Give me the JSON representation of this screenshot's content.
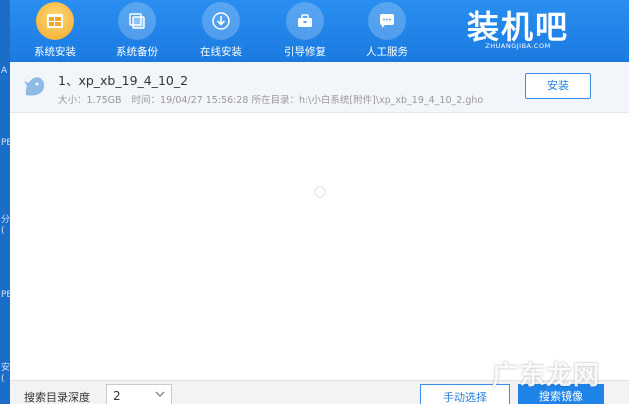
{
  "nav": {
    "items": [
      {
        "label": "系统安装",
        "icon": "windows-install-icon",
        "active": true
      },
      {
        "label": "系统备份",
        "icon": "backup-icon",
        "active": false
      },
      {
        "label": "在线安装",
        "icon": "download-icon",
        "active": false
      },
      {
        "label": "引导修复",
        "icon": "toolbox-icon",
        "active": false
      },
      {
        "label": "人工服务",
        "icon": "chat-icon",
        "active": false
      }
    ]
  },
  "logo": {
    "text": "装机吧",
    "sub": "ZHUANGJIBA.COM"
  },
  "left_strip": {
    "chars": [
      "A",
      "PE",
      "分",
      "(",
      "PE",
      "安",
      "("
    ]
  },
  "image_list": [
    {
      "title": "1、xp_xb_19_4_10_2",
      "size_label": "大小：1.75GB",
      "time_label": "时间：19/04/27 15:56:28",
      "path_label": "所在目录：h:\\小白系统[附件]\\xp_xb_19_4_10_2.gho",
      "action_label": "安装"
    }
  ],
  "bottom": {
    "depth_label": "搜索目录深度",
    "depth_value": "2",
    "manual_label": "手动选择",
    "search_label": "搜索镜像"
  },
  "watermark": {
    "text": "广东龙网"
  },
  "colors": {
    "topbar": "#1a7ae0",
    "accent": "#2a7fe0",
    "active_icon": "#f3a728"
  }
}
